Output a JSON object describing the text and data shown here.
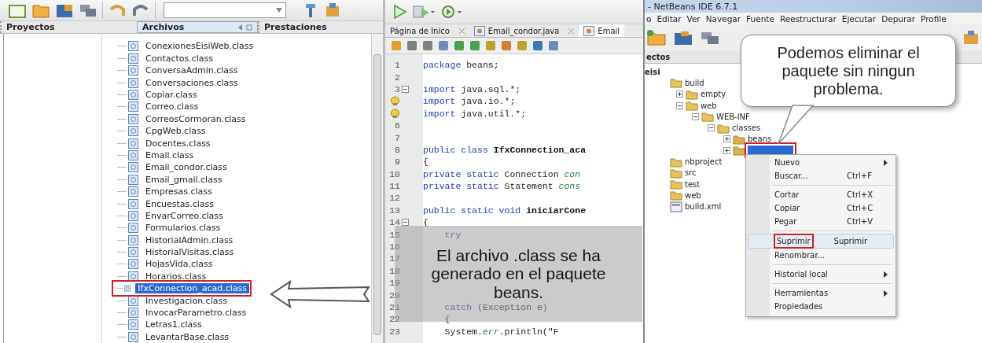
{
  "files_panel": {
    "tabs": [
      {
        "label": "Proyectos",
        "selected": false
      },
      {
        "label": "Archivos",
        "selected": true
      },
      {
        "label": "Prestaciones",
        "selected": false
      }
    ],
    "files": [
      {
        "name": "ConexionesEisiWeb.class",
        "selected": false
      },
      {
        "name": "Contactos.class",
        "selected": false
      },
      {
        "name": "ConversaAdmin.class",
        "selected": false
      },
      {
        "name": "Conversaciones.class",
        "selected": false
      },
      {
        "name": "Copiar.class",
        "selected": false
      },
      {
        "name": "Correo.class",
        "selected": false
      },
      {
        "name": "CorreosCormoran.class",
        "selected": false
      },
      {
        "name": "CpgWeb.class",
        "selected": false
      },
      {
        "name": "Docentes.class",
        "selected": false
      },
      {
        "name": "Email.class",
        "selected": false
      },
      {
        "name": "Email_condor.class",
        "selected": false
      },
      {
        "name": "Email_gmail.class",
        "selected": false
      },
      {
        "name": "Empresas.class",
        "selected": false
      },
      {
        "name": "Encuestas.class",
        "selected": false
      },
      {
        "name": "EnvarCorreo.class",
        "selected": false
      },
      {
        "name": "Formularios.class",
        "selected": false
      },
      {
        "name": "HistorialAdmin.class",
        "selected": false
      },
      {
        "name": "HistorialVisitas.class",
        "selected": false
      },
      {
        "name": "HojasVida.class",
        "selected": false
      },
      {
        "name": "Horarios.class",
        "selected": false
      },
      {
        "name": "IfxConnection_acad.class",
        "selected": true
      },
      {
        "name": "Investigacion.class",
        "selected": false
      },
      {
        "name": "InvocarParametro.class",
        "selected": false
      },
      {
        "name": "Letras1.class",
        "selected": false
      },
      {
        "name": "LevantarBase.class",
        "selected": false
      }
    ],
    "callout": "El archivo .class se ha generado en el paquete beans."
  },
  "editor": {
    "tabs": [
      {
        "label": "Página de Inico",
        "selected": false
      },
      {
        "label": "Email_condor.java",
        "selected": false
      },
      {
        "label": "Email",
        "selected": true
      }
    ],
    "lines": [
      {
        "number": "1",
        "tokens": [
          {
            "text": "package",
            "kind": "keyword"
          },
          {
            "text": " beans;",
            "kind": "plain"
          }
        ]
      },
      {
        "number": "2"
      },
      {
        "number": "3",
        "fold": true,
        "tokens": [
          {
            "text": "import",
            "kind": "keyword"
          },
          {
            "text": " java.sql.*;",
            "kind": "plain"
          }
        ]
      },
      {
        "hint": true,
        "tokens": [
          {
            "text": "import",
            "kind": "keyword"
          },
          {
            "text": " java.io.*;",
            "kind": "plain"
          }
        ]
      },
      {
        "hint": true,
        "tokens": [
          {
            "text": "import",
            "kind": "keyword"
          },
          {
            "text": " java.util.*;",
            "kind": "plain"
          }
        ]
      },
      {
        "number": "6"
      },
      {
        "number": "7"
      },
      {
        "number": "8",
        "tokens": [
          {
            "text": "public class",
            "kind": "keyword"
          },
          {
            "text": " IfxConnection_aca",
            "kind": "bold"
          }
        ]
      },
      {
        "number": "9",
        "tokens": [
          {
            "text": "{",
            "kind": "plain"
          }
        ]
      },
      {
        "number": "10",
        "tokens": [
          {
            "text": "private static",
            "kind": "keyword"
          },
          {
            "text": " Connection ",
            "kind": "plain"
          },
          {
            "text": "con",
            "kind": "field"
          }
        ]
      },
      {
        "number": "11",
        "tokens": [
          {
            "text": "private static",
            "kind": "keyword"
          },
          {
            "text": " Statement ",
            "kind": "plain"
          },
          {
            "text": "cons",
            "kind": "field"
          }
        ]
      },
      {
        "number": "12"
      },
      {
        "number": "13",
        "tokens": [
          {
            "text": "public static void",
            "kind": "keyword"
          },
          {
            "text": " iniciarCone",
            "kind": "bold"
          }
        ]
      },
      {
        "number": "14",
        "fold": true,
        "tokens": [
          {
            "text": "{",
            "kind": "plain"
          }
        ]
      },
      {
        "number": "15",
        "tokens": [
          {
            "text": "    try",
            "kind": "keyword"
          }
        ]
      },
      {
        "number": "16"
      },
      {
        "number": "17"
      },
      {
        "number": "18"
      },
      {
        "number": "19"
      },
      {
        "number": "20"
      },
      {
        "number": "21",
        "tokens": [
          {
            "text": "    catch",
            "kind": "keyword"
          },
          {
            "text": " (Exception e)",
            "kind": "plain"
          }
        ]
      },
      {
        "number": "22",
        "tokens": [
          {
            "text": "    {",
            "kind": "plain"
          }
        ]
      },
      {
        "number": "23",
        "tokens": [
          {
            "text": "    System.",
            "kind": "plain"
          },
          {
            "text": "err",
            "kind": "field"
          },
          {
            "text": ".println(\"F",
            "kind": "plain"
          }
        ]
      }
    ]
  },
  "ide": {
    "title": "- NetBeans IDE 6.7.1",
    "menu": [
      "o",
      "Editar",
      "Ver",
      "Navegar",
      "Fuente",
      "Reestructurar",
      "Ejecutar",
      "Depurar",
      "Profile"
    ],
    "panel_tab": "ectos",
    "tree": [
      {
        "label": "eisi",
        "kind": "project",
        "children": [
          {
            "label": "build",
            "kind": "folder",
            "children": [
              {
                "label": "empty",
                "kind": "folder",
                "expanded": false
              },
              {
                "label": "web",
                "kind": "folder",
                "expanded": true,
                "children": [
                  {
                    "label": "WEB-INF",
                    "kind": "folder",
                    "expanded": true,
                    "children": [
                      {
                        "label": "classes",
                        "kind": "folder",
                        "expanded": true,
                        "children": [
                          {
                            "label": "beans",
                            "kind": "package",
                            "expanded": false
                          },
                          {
                            "kind": "package",
                            "expanded": false,
                            "selected": true
                          }
                        ]
                      }
                    ]
                  }
                ]
              }
            ]
          },
          {
            "label": "nbproject",
            "kind": "folder"
          },
          {
            "label": "src",
            "kind": "folder"
          },
          {
            "label": "test",
            "kind": "folder"
          },
          {
            "label": "web",
            "kind": "folder"
          },
          {
            "label": "build.xml",
            "kind": "file"
          }
        ]
      }
    ],
    "context_menu": [
      {
        "kind": "item",
        "label": "Nuevo",
        "submenu": true,
        "hovered": false
      },
      {
        "kind": "item",
        "label": "Buscar...",
        "shortcut": "Ctrl+F",
        "hovered": false
      },
      {
        "kind": "separator"
      },
      {
        "kind": "item",
        "label": "Cortar",
        "shortcut": "Ctrl+X",
        "hovered": false
      },
      {
        "kind": "item",
        "label": "Copiar",
        "shortcut": "Ctrl+C",
        "hovered": false
      },
      {
        "kind": "item",
        "label": "Pegar",
        "shortcut": "Ctrl+V",
        "hovered": false
      },
      {
        "kind": "separator"
      },
      {
        "kind": "item",
        "label": "Suprimir",
        "shortcut": "Suprimir",
        "hovered": true
      },
      {
        "kind": "item",
        "label": "Renombrar...",
        "hovered": false
      },
      {
        "kind": "separator"
      },
      {
        "kind": "item",
        "label": "Historial local",
        "submenu": true,
        "hovered": false
      },
      {
        "kind": "separator"
      },
      {
        "kind": "item",
        "label": "Herramientas",
        "submenu": true,
        "hovered": false
      },
      {
        "kind": "item",
        "label": "Propiedades",
        "hovered": false
      }
    ],
    "callout": "Podemos eliminar el paquete sin ningun problema."
  }
}
